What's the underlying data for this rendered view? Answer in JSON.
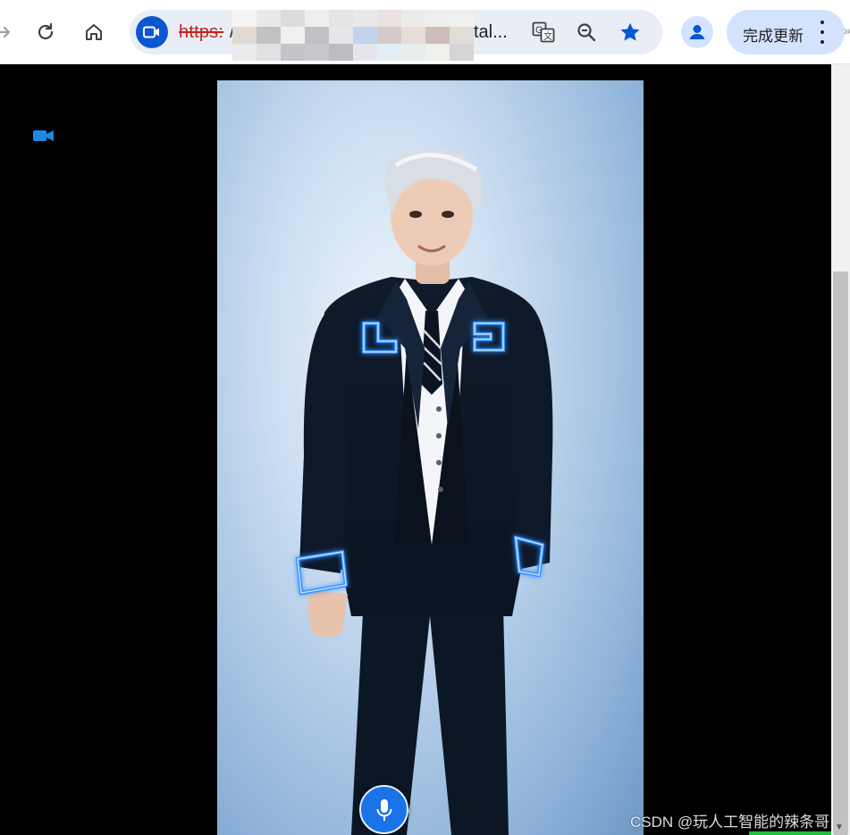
{
  "browser": {
    "url_scheme": "https:",
    "url_separator": "/",
    "url_tail": "tal...",
    "update_button_label": "完成更新",
    "icons": {
      "forward": "forward-arrow-icon",
      "reload": "reload-icon",
      "home": "home-icon",
      "site": "video-camera-icon",
      "translate": "translate-icon",
      "zoom": "zoom-out-icon",
      "bookmark": "star-icon",
      "profile": "profile-icon",
      "menu": "more-vert-icon"
    },
    "colors": {
      "accent": "#0b57d0",
      "insecure_scheme": "#c5221f",
      "update_pill": "#d3e3fd"
    }
  },
  "page": {
    "background": "#000000",
    "camera_indicator": "video-camera-icon",
    "mic_button": "microphone-icon",
    "watermark": "CSDN @玩人工智能的辣条哥"
  }
}
